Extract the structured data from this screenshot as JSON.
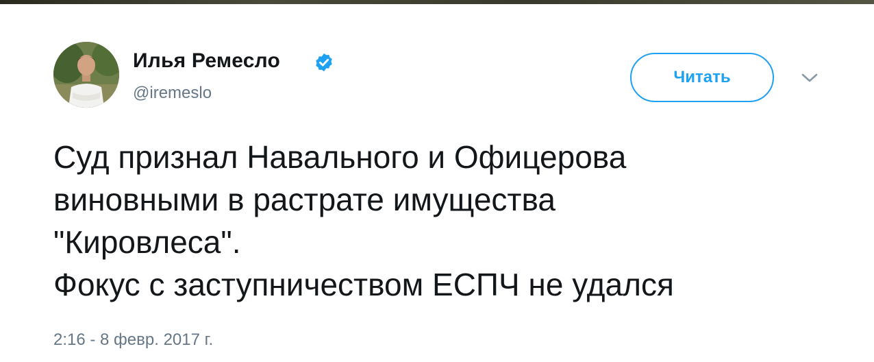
{
  "tweet": {
    "author_name": "Илья Ремесло",
    "author_handle": "@iremeslo",
    "verified": true,
    "follow_label": "Читать",
    "text_lines": [
      "Суд признал Навального и Офицерова",
      "виновными в растрате имущества",
      "\"Кировлеса\".",
      "Фокус с заступничеством ЕСПЧ не удался"
    ],
    "timestamp": "2:16 - 8 февр. 2017 г."
  },
  "icons": {
    "verified": "verified-badge-icon",
    "menu": "chevron-down-icon",
    "avatar": "profile-photo"
  },
  "colors": {
    "accent": "#1da1f2",
    "text": "#14171a",
    "muted": "#657786"
  }
}
